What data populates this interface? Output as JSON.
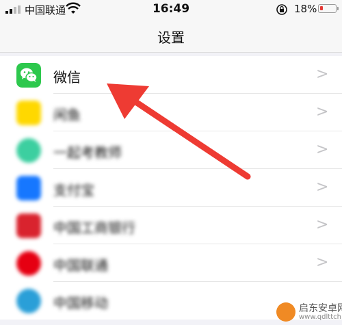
{
  "status_bar": {
    "carrier": "中国联通",
    "time": "16:49",
    "battery_percent": "18%",
    "battery_level": 0.18,
    "icons": [
      "signal-icon",
      "wifi-icon",
      "rotation-lock-icon",
      "battery-icon"
    ]
  },
  "nav": {
    "title": "设置"
  },
  "list": {
    "items": [
      {
        "label": "微信",
        "icon": "wechat-icon",
        "color": "#2dc84d",
        "blurred": false
      },
      {
        "label": "闲鱼",
        "icon": "xianyu-icon",
        "color": "#ffd800",
        "blurred": true
      },
      {
        "label": "一起考教师",
        "icon": "teacher-app-icon",
        "color": "#3ccfa0",
        "blurred": true
      },
      {
        "label": "支付宝",
        "icon": "alipay-icon",
        "color": "#1677ff",
        "blurred": true
      },
      {
        "label": "中国工商银行",
        "icon": "icbc-icon",
        "color": "#d9232e",
        "blurred": true
      },
      {
        "label": "中国联通",
        "icon": "china-unicom-icon",
        "color": "#e60012",
        "blurred": true
      },
      {
        "label": "中国移动",
        "icon": "china-mobile-icon",
        "color": "#2a9fd8",
        "blurred": true
      }
    ]
  },
  "annotation": {
    "arrow_color": "#ee3b33"
  },
  "watermark": {
    "line1": "启东安卓网",
    "line2": "www.qdlttch.com"
  }
}
